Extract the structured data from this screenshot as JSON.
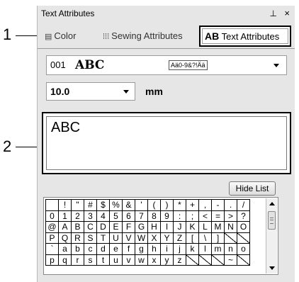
{
  "callouts": {
    "one": "1",
    "two": "2"
  },
  "panel": {
    "title": "Text Attributes",
    "pin_glyph": "⊥",
    "close_glyph": "×"
  },
  "tabs": {
    "color": {
      "icon": "▤",
      "label": "Color"
    },
    "sewing": {
      "icon": "⁞⁞⁞",
      "label": "Sewing Attributes"
    },
    "text": {
      "icon": "AB",
      "label": "Text Attributes"
    }
  },
  "font_select": {
    "number": "001",
    "sample": "ABC",
    "char_support": "Aä0-9&?!Ää"
  },
  "size_select": {
    "value": "10.0",
    "unit": "mm"
  },
  "text_input": {
    "value": "ABC"
  },
  "hide_list_button": "Hide List",
  "char_grid": [
    [
      " ",
      "!",
      "\"",
      "#",
      "$",
      "%",
      "&",
      "'",
      "(",
      ")",
      "*",
      "+",
      ",",
      "-",
      ".",
      "/"
    ],
    [
      "0",
      "1",
      "2",
      "3",
      "4",
      "5",
      "6",
      "7",
      "8",
      "9",
      ":",
      ";",
      "<",
      "=",
      ">",
      "?"
    ],
    [
      "@",
      "A",
      "B",
      "C",
      "D",
      "E",
      "F",
      "G",
      "H",
      "I",
      "J",
      "K",
      "L",
      "M",
      "N",
      "O"
    ],
    [
      "P",
      "Q",
      "R",
      "S",
      "T",
      "U",
      "V",
      "W",
      "X",
      "Y",
      "Z",
      "[",
      "\\",
      "]",
      "",
      ""
    ],
    [
      "`",
      "a",
      "b",
      "c",
      "d",
      "e",
      "f",
      "g",
      "h",
      "i",
      "j",
      "k",
      "l",
      "m",
      "n",
      "o"
    ],
    [
      "p",
      "q",
      "r",
      "s",
      "t",
      "u",
      "v",
      "w",
      "x",
      "y",
      "z",
      "",
      "",
      "",
      "~",
      ""
    ]
  ]
}
